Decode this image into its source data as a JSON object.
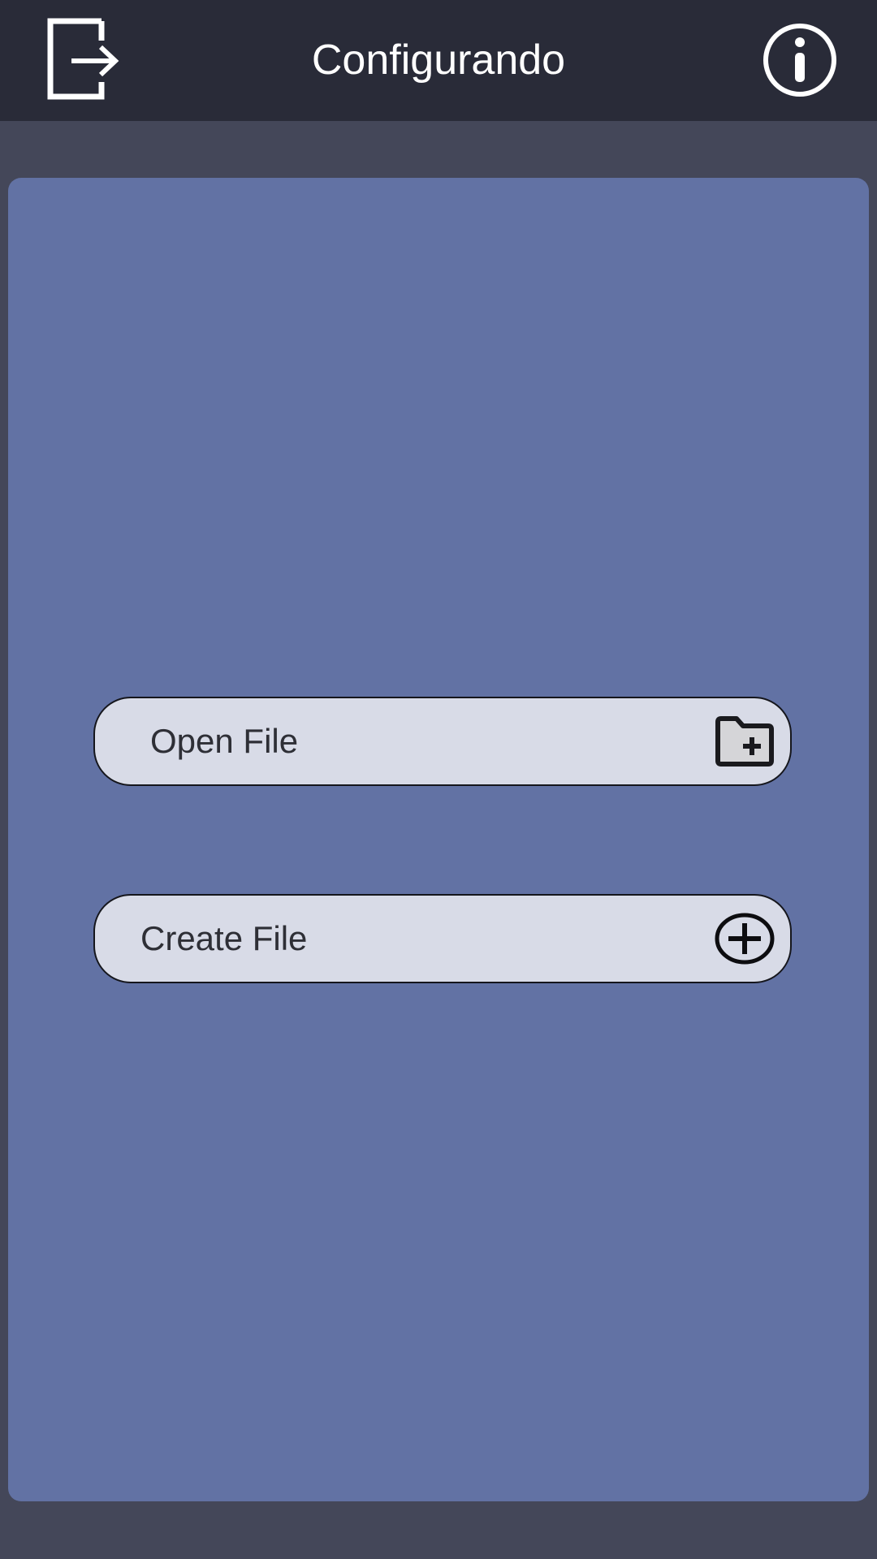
{
  "header": {
    "title": "Configurando",
    "exit_icon": "exit-icon",
    "info_icon": "info-icon"
  },
  "actions": [
    {
      "label": "Open File",
      "icon": "folder-plus-icon"
    },
    {
      "label": "Create File",
      "icon": "plus-circle-icon"
    }
  ],
  "colors": {
    "header_bg": "#292b38",
    "page_bg": "#444759",
    "panel_bg": "#6272a4",
    "button_bg": "#d8dbe7",
    "button_text": "#2e2f36"
  }
}
